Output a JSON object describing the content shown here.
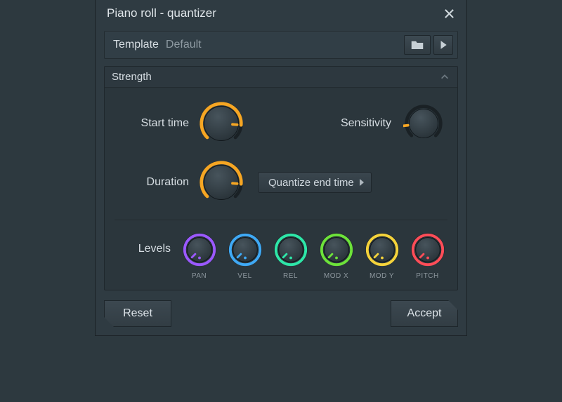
{
  "title": "Piano roll - quantizer",
  "template": {
    "label": "Template",
    "value": "Default"
  },
  "panel": {
    "header": "Strength",
    "start_time_label": "Start time",
    "sensitivity_label": "Sensitivity",
    "duration_label": "Duration",
    "quantize_mode": "Quantize end time"
  },
  "knobs": {
    "start_time": {
      "value": 0.85,
      "color": "#f6a623"
    },
    "sensitivity": {
      "value": 0.22,
      "color": "#f6a623",
      "dim": true
    },
    "duration": {
      "value": 0.85,
      "color": "#f6a623"
    }
  },
  "levels_label": "Levels",
  "levels": [
    {
      "id": "pan",
      "label": "PAN",
      "color": "#9b59ff",
      "value": 0.0
    },
    {
      "id": "vel",
      "label": "VEL",
      "color": "#3fa9f5",
      "value": 0.0
    },
    {
      "id": "rel",
      "label": "REL",
      "color": "#2ee6a8",
      "value": 0.0
    },
    {
      "id": "modx",
      "label": "MOD X",
      "color": "#6de23a",
      "value": 0.0
    },
    {
      "id": "mody",
      "label": "MOD Y",
      "color": "#f5d33b",
      "value": 0.0
    },
    {
      "id": "pitch",
      "label": "PITCH",
      "color": "#ff4d58",
      "value": 0.0
    }
  ],
  "footer": {
    "reset": "Reset",
    "accept": "Accept"
  }
}
